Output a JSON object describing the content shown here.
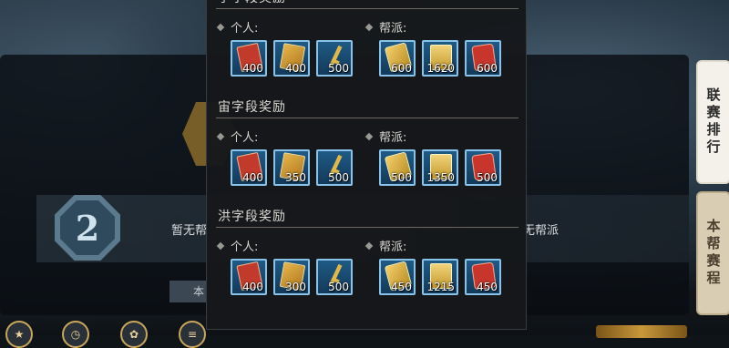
{
  "background": {
    "rank_number": "2",
    "left_text": "暂无帮",
    "right_text": "无帮派",
    "button_label": "本"
  },
  "side_tabs": [
    {
      "label": "联赛排行",
      "active": true
    },
    {
      "label": "本帮赛程",
      "active": false
    }
  ],
  "popup": {
    "sections": [
      {
        "title": "宇字段奖励",
        "personal_label": "个人:",
        "guild_label": "帮派:",
        "personal_items": [
          {
            "icon": "red-scroll-icon",
            "qty": "400"
          },
          {
            "icon": "gold-card-icon",
            "qty": "400"
          },
          {
            "icon": "gold-key-icon",
            "qty": "500"
          }
        ],
        "guild_items": [
          {
            "icon": "gold-stack-icon",
            "qty": "600"
          },
          {
            "icon": "gold-token-icon",
            "qty": "1620"
          },
          {
            "icon": "red-chest-icon",
            "qty": "600"
          }
        ]
      },
      {
        "title": "宙字段奖励",
        "personal_label": "个人:",
        "guild_label": "帮派:",
        "personal_items": [
          {
            "icon": "red-scroll-icon",
            "qty": "400"
          },
          {
            "icon": "gold-card-icon",
            "qty": "350"
          },
          {
            "icon": "gold-key-icon",
            "qty": "500"
          }
        ],
        "guild_items": [
          {
            "icon": "gold-stack-icon",
            "qty": "500"
          },
          {
            "icon": "gold-token-icon",
            "qty": "1350"
          },
          {
            "icon": "red-chest-icon",
            "qty": "500"
          }
        ]
      },
      {
        "title": "洪字段奖励",
        "personal_label": "个人:",
        "guild_label": "帮派:",
        "personal_items": [
          {
            "icon": "red-scroll-icon",
            "qty": "400"
          },
          {
            "icon": "gold-card-icon",
            "qty": "300"
          },
          {
            "icon": "gold-key-icon",
            "qty": "500"
          }
        ],
        "guild_items": [
          {
            "icon": "gold-stack-icon",
            "qty": "450"
          },
          {
            "icon": "gold-token-icon",
            "qty": "1215"
          },
          {
            "icon": "red-chest-icon",
            "qty": "450"
          }
        ]
      }
    ]
  }
}
